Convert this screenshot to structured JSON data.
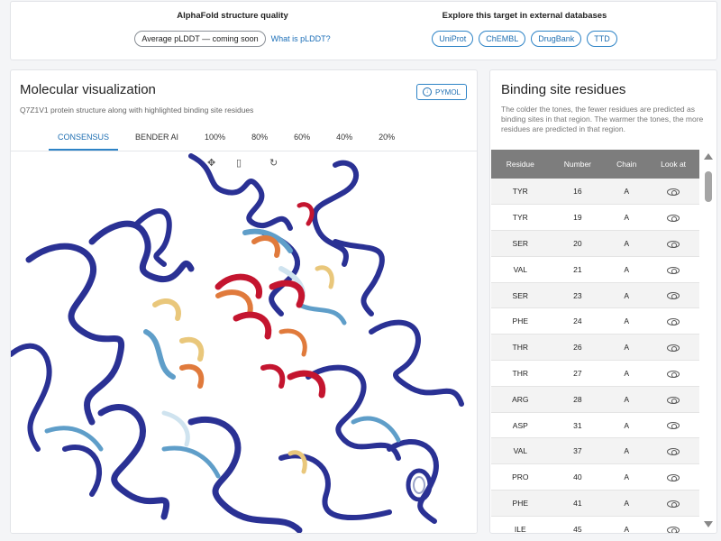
{
  "alphafold": {
    "title": "AlphaFold structure quality",
    "plddt_label": "Average pLDDT — coming soon",
    "plddt_link": "What is pLDDT?"
  },
  "external": {
    "title": "Explore this target in external databases",
    "databases": [
      "UniProt",
      "ChEMBL",
      "DrugBank",
      "TTD"
    ]
  },
  "molecular": {
    "title": "Molecular visualization",
    "subtitle": "Q7Z1V1 protein structure along with highlighted binding site residues",
    "pymol_label": "PYMOL",
    "tabs": [
      "CONSENSUS",
      "BENDER AI",
      "100%",
      "80%",
      "60%",
      "40%",
      "20%"
    ],
    "active_tab": "CONSENSUS",
    "viewer_controls": [
      "move-icon",
      "mouse-icon",
      "reset-icon"
    ],
    "colors": {
      "backbone": "#2a3194",
      "light_blue": "#5f9ec9",
      "pale": "#cfe3ef",
      "yellow": "#e9c77b",
      "orange": "#e07a3c",
      "red": "#c4152f"
    }
  },
  "binding": {
    "title": "Binding site residues",
    "description": "The colder the tones, the fewer residues are predicted as binding sites in that region. The warmer the tones, the more residues are predicted in that region.",
    "columns": [
      "Residue",
      "Number",
      "Chain",
      "Look at"
    ],
    "rows": [
      {
        "residue": "TYR",
        "number": "16",
        "chain": "A"
      },
      {
        "residue": "TYR",
        "number": "19",
        "chain": "A"
      },
      {
        "residue": "SER",
        "number": "20",
        "chain": "A"
      },
      {
        "residue": "VAL",
        "number": "21",
        "chain": "A"
      },
      {
        "residue": "SER",
        "number": "23",
        "chain": "A"
      },
      {
        "residue": "PHE",
        "number": "24",
        "chain": "A"
      },
      {
        "residue": "THR",
        "number": "26",
        "chain": "A"
      },
      {
        "residue": "THR",
        "number": "27",
        "chain": "A"
      },
      {
        "residue": "ARG",
        "number": "28",
        "chain": "A"
      },
      {
        "residue": "ASP",
        "number": "31",
        "chain": "A"
      },
      {
        "residue": "VAL",
        "number": "37",
        "chain": "A"
      },
      {
        "residue": "PRO",
        "number": "40",
        "chain": "A"
      },
      {
        "residue": "PHE",
        "number": "41",
        "chain": "A"
      },
      {
        "residue": "ILE",
        "number": "45",
        "chain": "A"
      }
    ]
  }
}
